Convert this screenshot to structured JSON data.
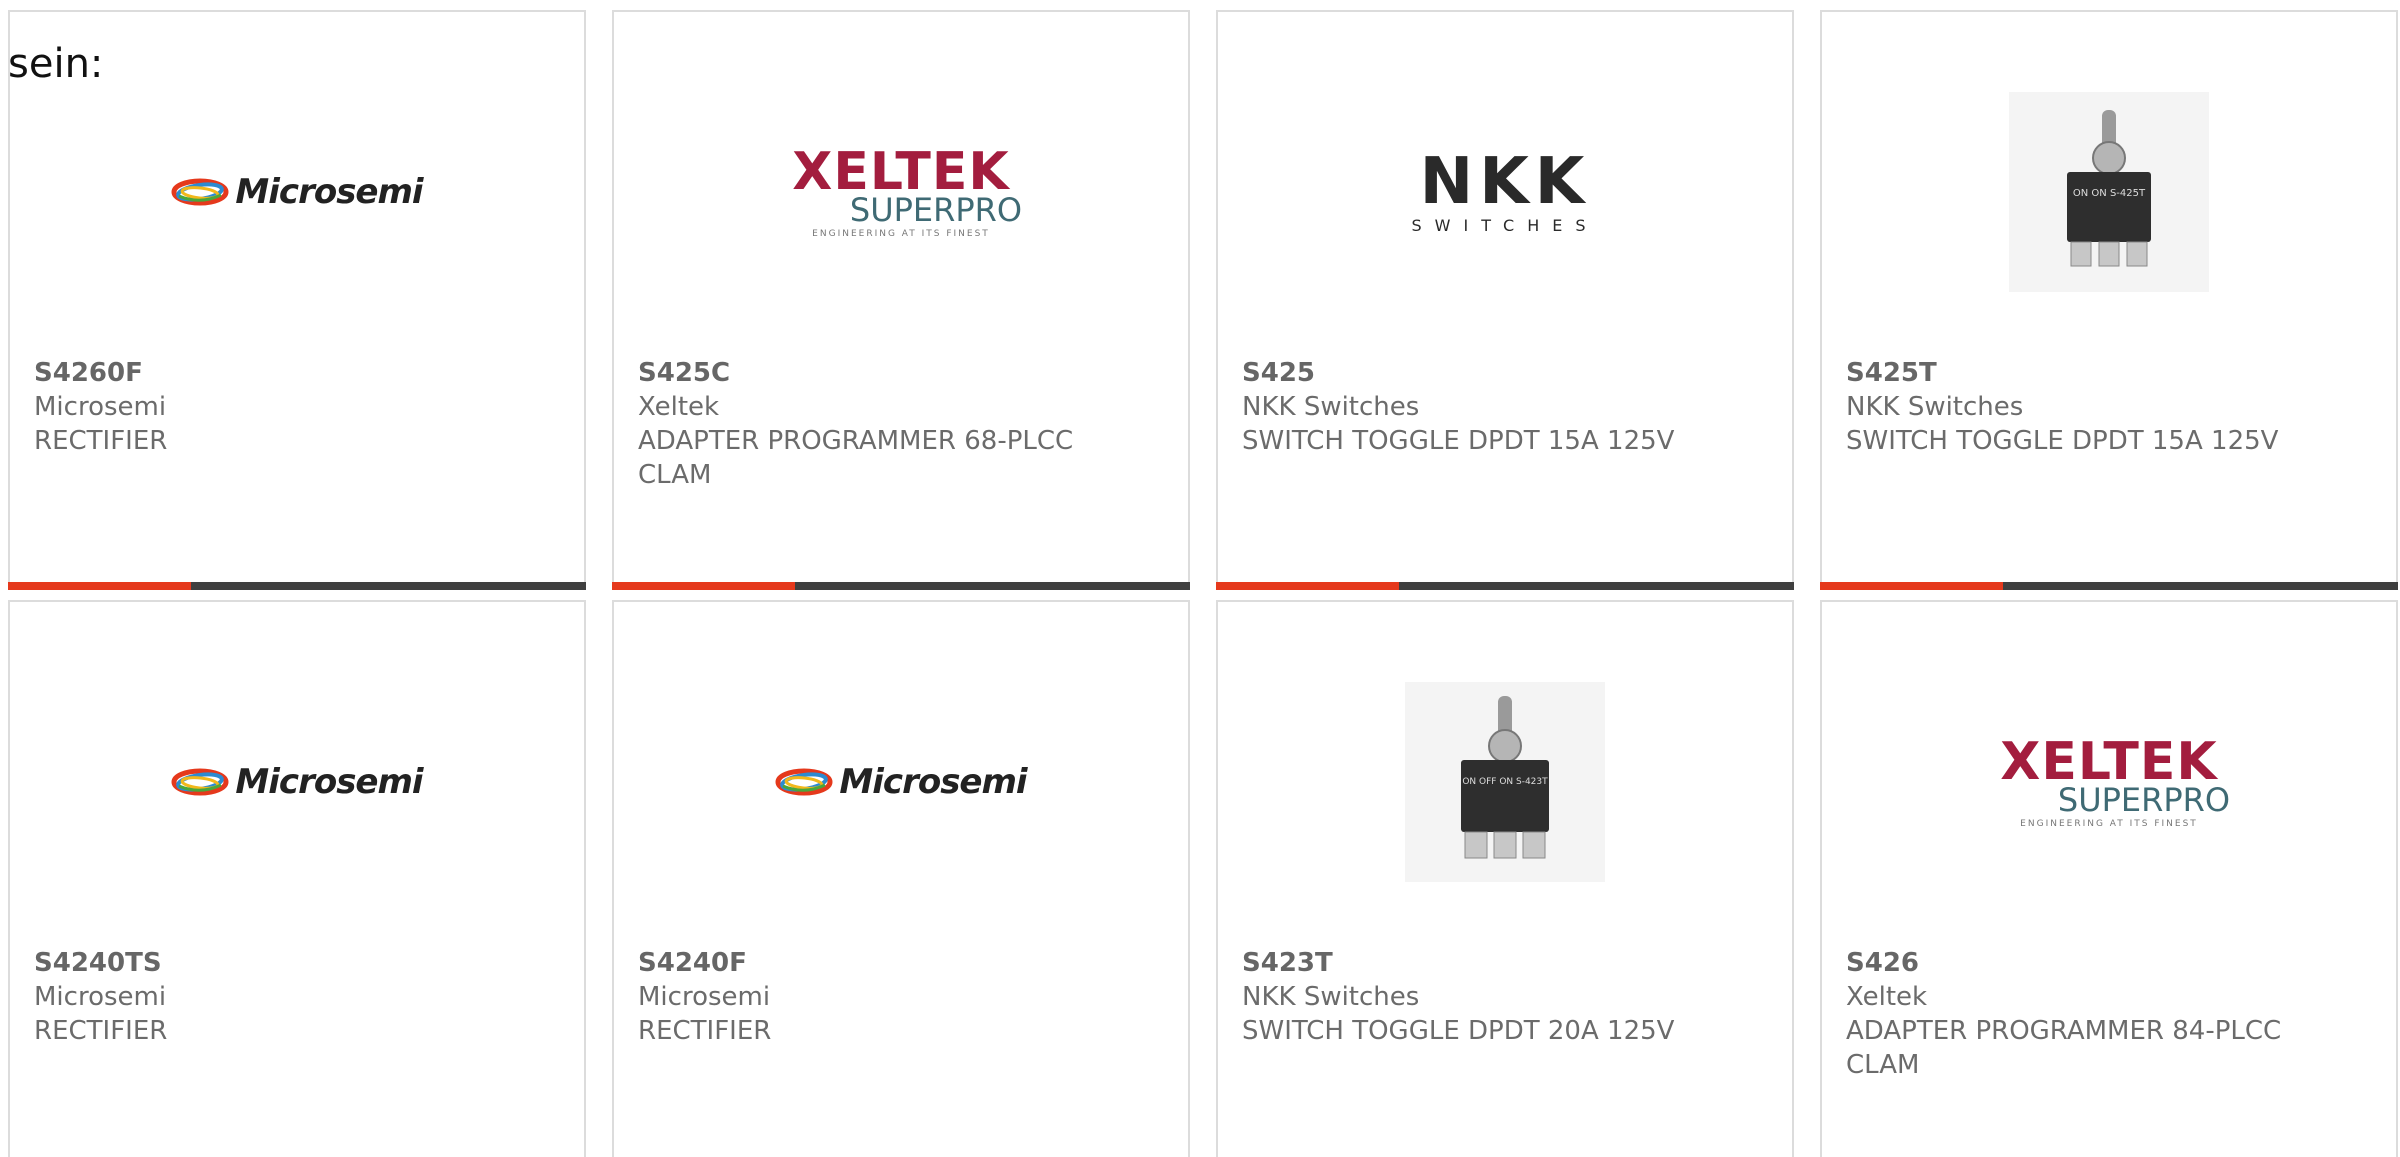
{
  "intro": {
    "text": "sein:"
  },
  "colors": {
    "accent": "#e5391c",
    "bar": "#3f3f3f",
    "border": "#dcdcdc"
  },
  "products": [
    {
      "part": "S4260F",
      "manufacturer": "Microsemi",
      "description": "RECTIFIER",
      "logo": "microsemi-logo",
      "logo_text": "Microsemi"
    },
    {
      "part": "S425C",
      "manufacturer": "Xeltek",
      "description": "ADAPTER PROGRAMMER 68-PLCC CLAM",
      "logo": "xeltek-logo",
      "logo_text": "XELTEK",
      "logo_sub": "SUPERPRO",
      "logo_tag": "ENGINEERING AT ITS FINEST"
    },
    {
      "part": "S425",
      "manufacturer": "NKK Switches",
      "description": "SWITCH TOGGLE DPDT 15A 125V",
      "logo": "nkk-logo",
      "logo_text": "NKK",
      "logo_sub": "SWITCHES"
    },
    {
      "part": "S425T",
      "manufacturer": "NKK Switches",
      "description": "SWITCH TOGGLE DPDT 15A 125V",
      "logo": "toggle-switch-image",
      "logo_text": "ON ON S-425T"
    },
    {
      "part": "S4240TS",
      "manufacturer": "Microsemi",
      "description": "RECTIFIER",
      "logo": "microsemi-logo",
      "logo_text": "Microsemi"
    },
    {
      "part": "S4240F",
      "manufacturer": "Microsemi",
      "description": "RECTIFIER",
      "logo": "microsemi-logo",
      "logo_text": "Microsemi"
    },
    {
      "part": "S423T",
      "manufacturer": "NKK Switches",
      "description": "SWITCH TOGGLE DPDT 20A 125V",
      "logo": "toggle-switch-image",
      "logo_text": "ON OFF ON S-423T"
    },
    {
      "part": "S426",
      "manufacturer": "Xeltek",
      "description": "ADAPTER PROGRAMMER 84-PLCC CLAM",
      "logo": "xeltek-logo",
      "logo_text": "XELTEK",
      "logo_sub": "SUPERPRO",
      "logo_tag": "ENGINEERING AT ITS FINEST"
    }
  ]
}
